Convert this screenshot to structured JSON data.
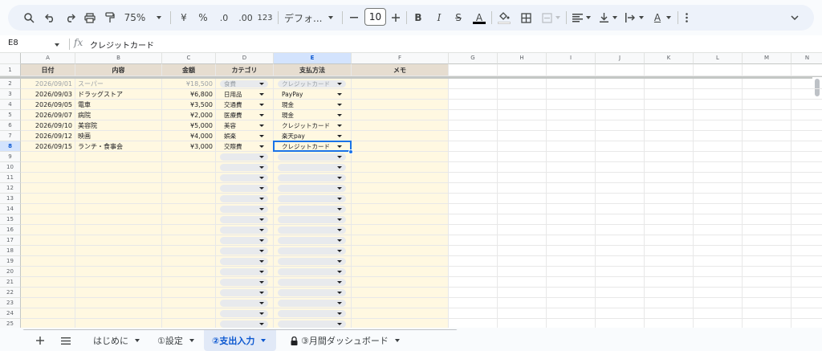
{
  "toolbar": {
    "zoom": "75%",
    "currency_label": "¥",
    "percent_label": "%",
    "dec_decrease_label": ".0",
    "dec_increase_label": ".00",
    "number_format_label": "123",
    "font_name": "デフォ...",
    "font_size": "10",
    "bold_label": "B",
    "italic_label": "I",
    "strike_label": "S",
    "textcolor_label": "A",
    "textcolor2_label": "A"
  },
  "formula_bar": {
    "cell_ref": "E8",
    "fx_label": "fx",
    "content": "クレジットカード"
  },
  "columns": [
    {
      "letter": "A",
      "header": "日付"
    },
    {
      "letter": "B",
      "header": "内容"
    },
    {
      "letter": "C",
      "header": "金額"
    },
    {
      "letter": "D",
      "header": "カテゴリ"
    },
    {
      "letter": "E",
      "header": "支払方法"
    },
    {
      "letter": "F",
      "header": "メモ"
    },
    {
      "letter": "G",
      "header": ""
    },
    {
      "letter": "H",
      "header": ""
    },
    {
      "letter": "I",
      "header": ""
    },
    {
      "letter": "J",
      "header": ""
    },
    {
      "letter": "K",
      "header": ""
    },
    {
      "letter": "L",
      "header": ""
    },
    {
      "letter": "M",
      "header": ""
    },
    {
      "letter": "N",
      "header": ""
    }
  ],
  "rows": [
    {
      "date": "2026/09/01",
      "content": "スーパー",
      "amount": "¥18,500",
      "category": "食費",
      "payment": "クレジットカード"
    },
    {
      "date": "2026/09/03",
      "content": "ドラッグストア",
      "amount": "¥6,800",
      "category": "日用品",
      "payment": "PayPay"
    },
    {
      "date": "2026/09/05",
      "content": "電車",
      "amount": "¥3,500",
      "category": "交通費",
      "payment": "現金"
    },
    {
      "date": "2026/09/07",
      "content": "病院",
      "amount": "¥2,000",
      "category": "医療費",
      "payment": "現金"
    },
    {
      "date": "2026/09/10",
      "content": "美容院",
      "amount": "¥5,000",
      "category": "美容",
      "payment": "クレジットカード"
    },
    {
      "date": "2026/09/12",
      "content": "映画",
      "amount": "¥4,000",
      "category": "娯楽",
      "payment": "楽天pay"
    },
    {
      "date": "2026/09/15",
      "content": "ランチ・食事会",
      "amount": "¥3,000",
      "category": "交際費",
      "payment": "クレジットカード"
    }
  ],
  "row_numbers": [
    "1",
    "2",
    "3",
    "4",
    "5",
    "6",
    "7",
    "8",
    "9",
    "10",
    "11",
    "12",
    "13",
    "14",
    "15",
    "16",
    "17",
    "18",
    "19",
    "20",
    "21",
    "22",
    "23",
    "24",
    "25"
  ],
  "sheet_tabs": [
    {
      "label": "はじめに",
      "active": false
    },
    {
      "label": "①設定",
      "active": false
    },
    {
      "label": "②支出入力",
      "active": true
    },
    {
      "label": "③月間ダッシュボード",
      "active": false,
      "locked": true
    }
  ],
  "colors": {
    "header_beige": "#e6ddd0",
    "fill_beige": "#fff8e1",
    "selection": "#1a73e8",
    "chip": "#e8eaed"
  }
}
